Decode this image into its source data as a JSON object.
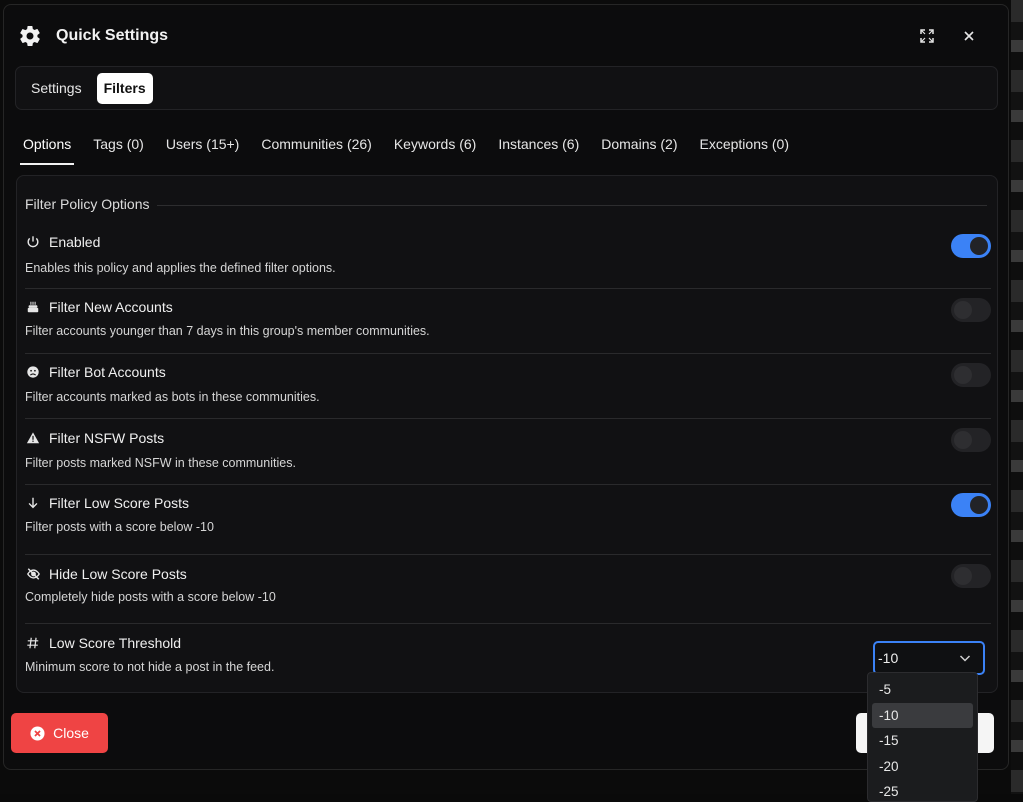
{
  "window": {
    "title": "Quick Settings"
  },
  "segments": [
    {
      "label": "Settings",
      "active": false
    },
    {
      "label": "Filters",
      "active": true
    }
  ],
  "tabs": [
    {
      "label": "Options",
      "active": true
    },
    {
      "label": "Tags (0)"
    },
    {
      "label": "Users (15+)"
    },
    {
      "label": "Communities (26)"
    },
    {
      "label": "Keywords (6)"
    },
    {
      "label": "Instances (6)"
    },
    {
      "label": "Domains (2)"
    },
    {
      "label": "Exceptions (0)"
    }
  ],
  "panel": {
    "legend": "Filter Policy Options",
    "options": [
      {
        "icon": "power-icon",
        "title": "Enabled",
        "desc": "Enables this policy and applies the defined filter options.",
        "on": true
      },
      {
        "icon": "cake-icon",
        "title": "Filter New Accounts",
        "desc": "Filter accounts younger than 7 days in this group's member communities.",
        "on": false
      },
      {
        "icon": "sad-face-icon",
        "title": "Filter Bot Accounts",
        "desc": "Filter accounts marked as bots in these communities.",
        "on": false
      },
      {
        "icon": "warning-icon",
        "title": "Filter NSFW Posts",
        "desc": "Filter posts marked NSFW in these communities.",
        "on": false
      },
      {
        "icon": "arrow-down-icon",
        "title": "Filter Low Score Posts",
        "desc": "Filter posts with a score below -10",
        "on": true
      },
      {
        "icon": "eye-off-icon",
        "title": "Hide Low Score Posts",
        "desc": "Completely hide posts with a score below -10",
        "on": false
      },
      {
        "icon": "hash-icon",
        "title": "Low Score Threshold",
        "desc": "Minimum score to not hide a post in the feed."
      }
    ],
    "threshold": {
      "value": "-10",
      "options": [
        "-5",
        "-10",
        "-15",
        "-20",
        "-25"
      ]
    }
  },
  "footer": {
    "close_label": "Close"
  },
  "colors": {
    "accent": "#3b82f6",
    "danger": "#ef4444"
  }
}
